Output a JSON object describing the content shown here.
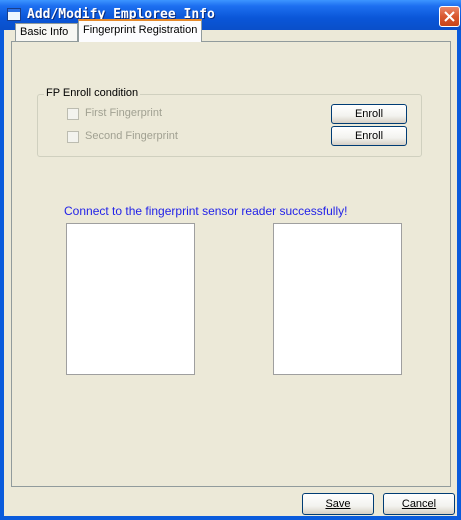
{
  "window": {
    "title": "Add/Modify Emploree Info",
    "icon": "window-app-icon",
    "close_icon": "close-icon"
  },
  "tabs": [
    {
      "label": "Basic Info",
      "active": false
    },
    {
      "label": "Fingerprint Registration",
      "active": true
    }
  ],
  "enroll": {
    "group_label": "FP Enroll condition",
    "first": {
      "label": "First Fingerprint",
      "checked": false,
      "enabled": false,
      "button": "Enroll"
    },
    "second": {
      "label": "Second Fingerprint",
      "checked": false,
      "enabled": false,
      "button": "Enroll"
    }
  },
  "status": {
    "message": "Connect to the fingerprint sensor reader successfully!",
    "color": "#2323e8"
  },
  "footer": {
    "save_label": "Save",
    "cancel_label": "Cancel"
  },
  "colors": {
    "titlebar": "#0a56d8",
    "dialog_bg": "#ece9d8",
    "active_tab_accent": "#e68b2c",
    "close_button": "#d9572f"
  }
}
